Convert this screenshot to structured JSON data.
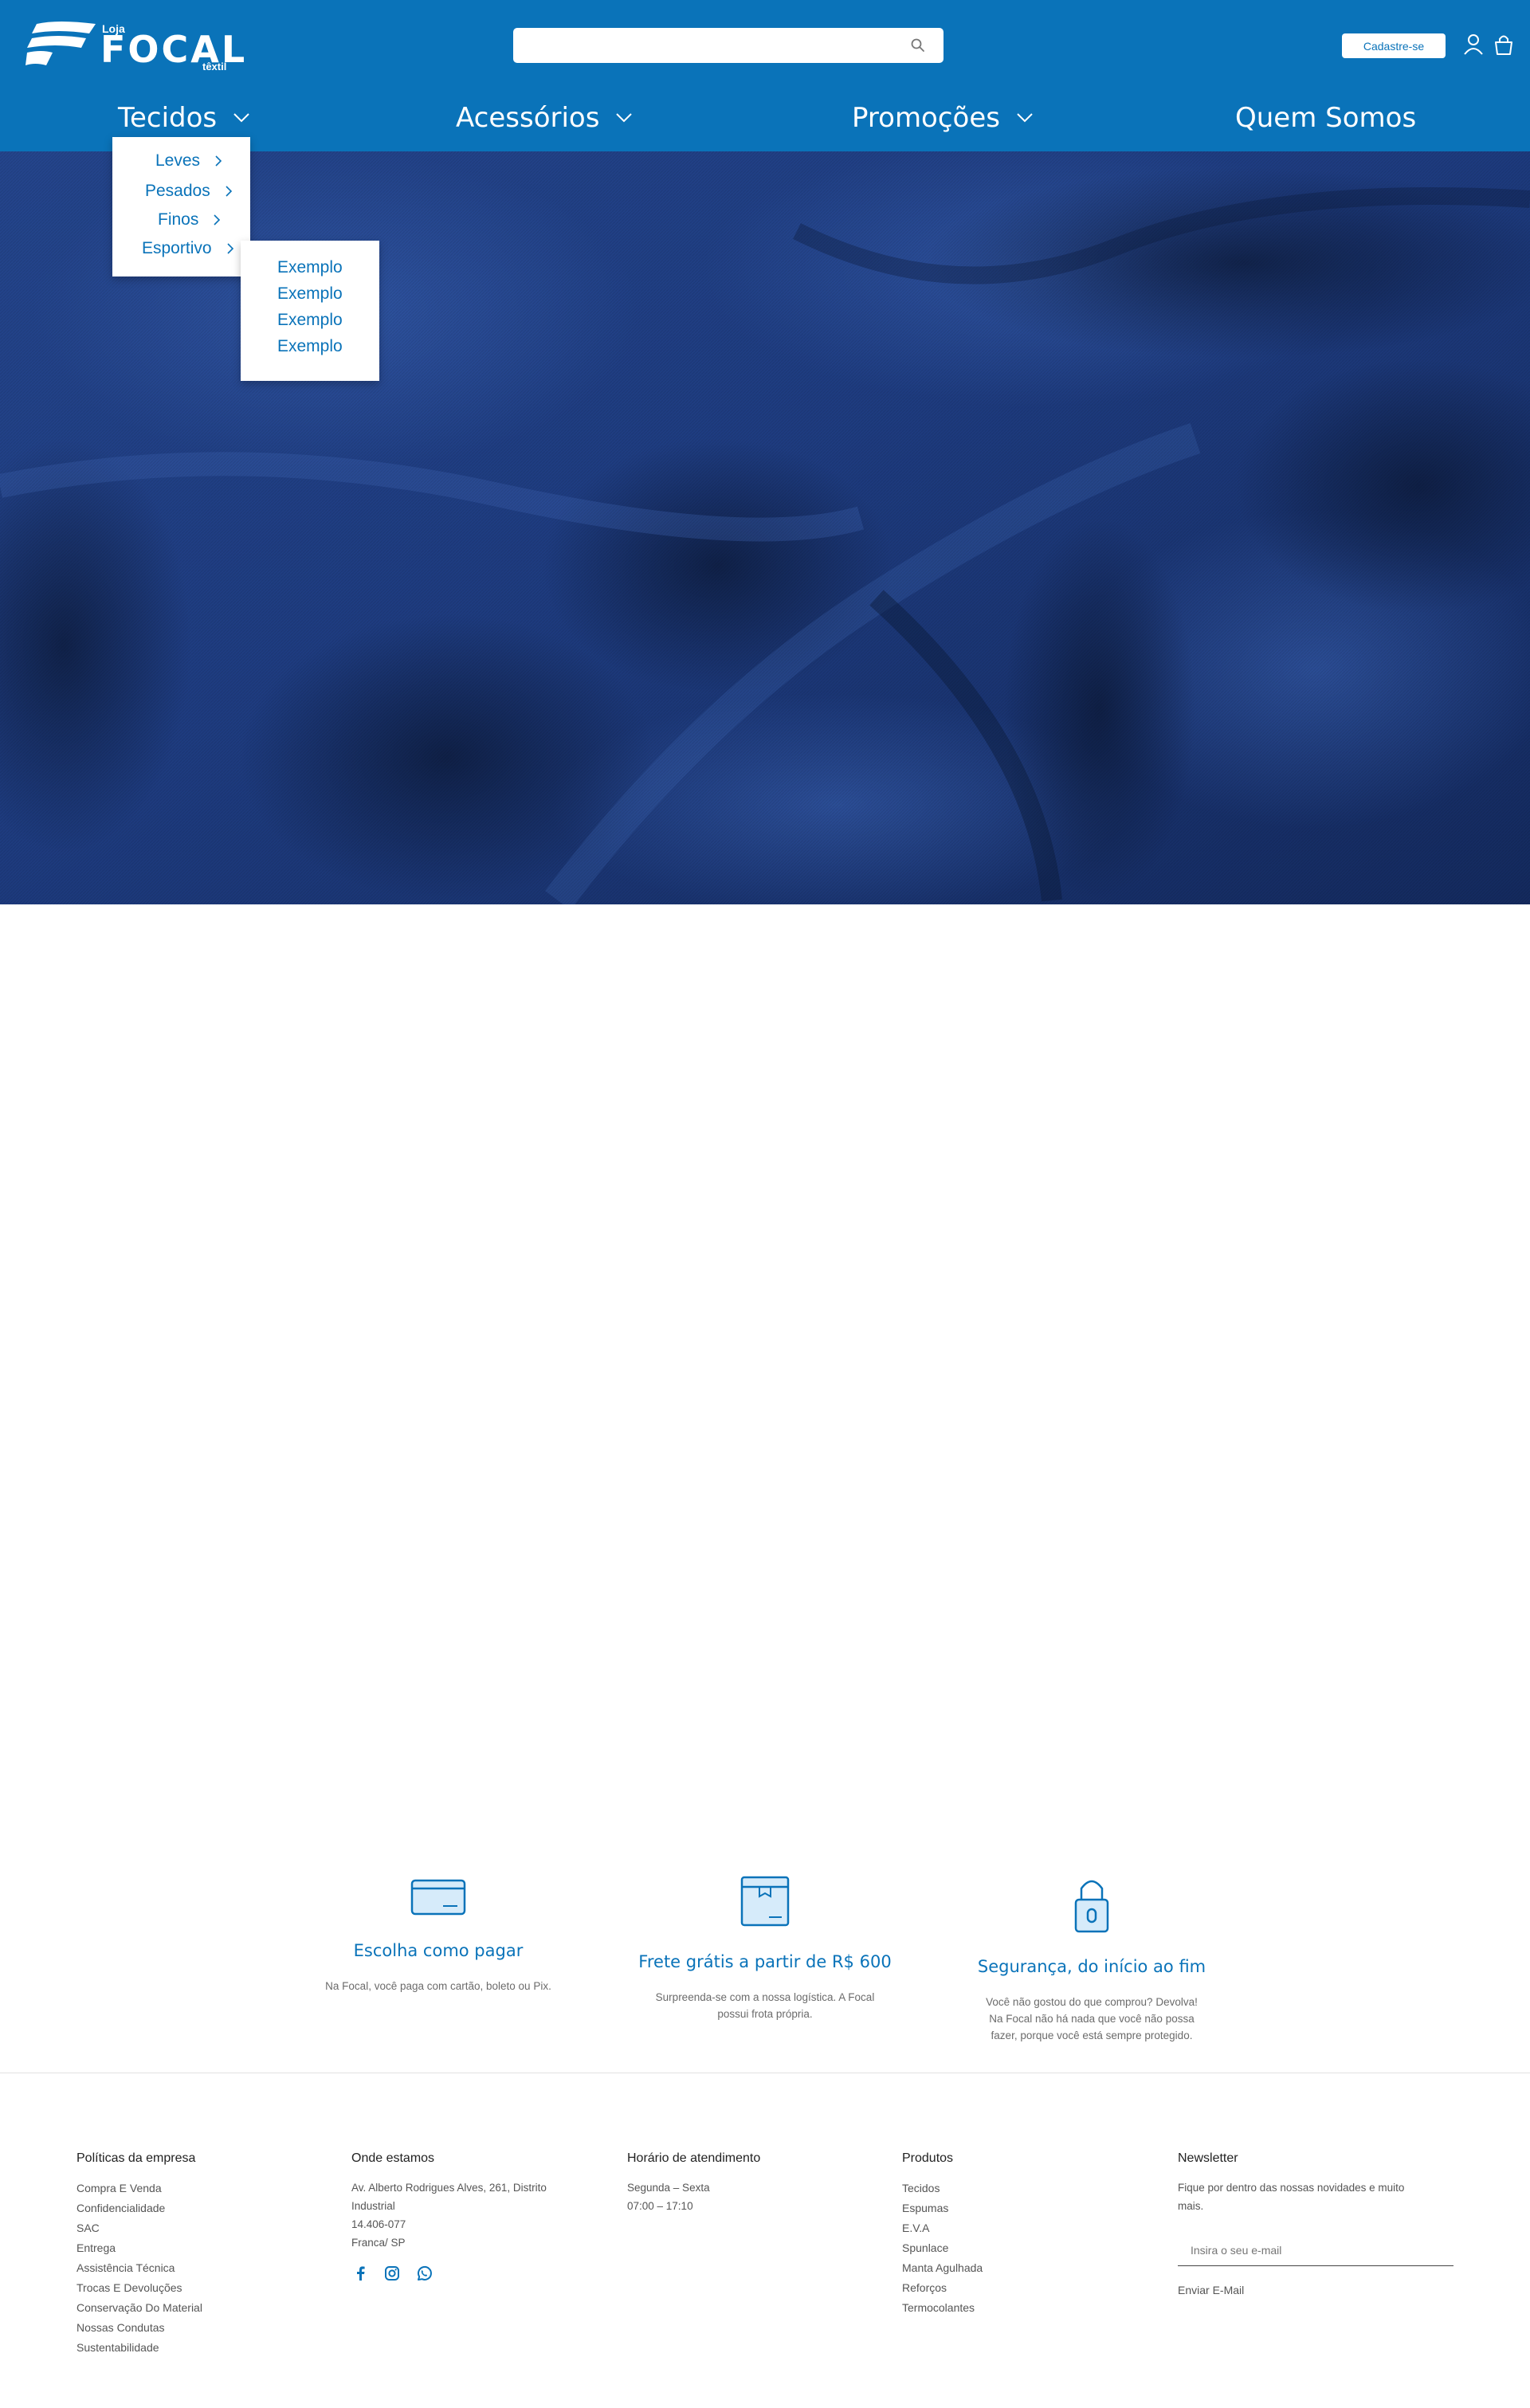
{
  "brand": {
    "logo_small": "Loja",
    "logo_big": "FOCAL",
    "logo_sub": "têxtil"
  },
  "header": {
    "search_placeholder": "",
    "signup_label": "Cadastre-se"
  },
  "nav": {
    "items": [
      {
        "label": "Tecidos",
        "has_dropdown": true
      },
      {
        "label": "Acessórios",
        "has_dropdown": true
      },
      {
        "label": "Promoções",
        "has_dropdown": true
      },
      {
        "label": "Quem Somos",
        "has_dropdown": false
      }
    ]
  },
  "dropdown": {
    "items": [
      "Leves",
      "Pesados",
      "Finos",
      "Esportivo"
    ],
    "submenu": [
      "Exemplo",
      "Exemplo",
      "Exemplo",
      "Exemplo"
    ]
  },
  "features": [
    {
      "icon": "credit-card-icon",
      "title": "Escolha como pagar",
      "text": "Na Focal, você paga com cartão, boleto ou Pix."
    },
    {
      "icon": "box-icon",
      "title": "Frete grátis a partir de R$ 600",
      "text": "Surpreenda-se com a nossa logística. A Focal possui frota própria."
    },
    {
      "icon": "lock-icon",
      "title": "Segurança, do início ao fim",
      "text": "Você não gostou do que comprou? Devolva! Na Focal não há nada que você não possa fazer, porque você está sempre protegido."
    }
  ],
  "footer": {
    "policies": {
      "title": "Políticas da empresa",
      "items": [
        "Compra E Venda",
        "Confidencialidade",
        "SAC",
        "Entrega",
        "Assistência Técnica",
        "Trocas E Devoluções",
        "Conservação Do Material",
        "Nossas Condutas",
        "Sustentabilidade"
      ]
    },
    "location": {
      "title": "Onde estamos",
      "lines": [
        "Av. Alberto Rodrigues Alves, 261, Distrito Industrial",
        "14.406-077",
        "Franca/ SP"
      ]
    },
    "hours": {
      "title": "Horário de atendimento",
      "lines": [
        "Segunda – Sexta",
        "07:00 – 17:10"
      ]
    },
    "products": {
      "title": "Produtos",
      "items": [
        "Tecidos",
        "Espumas",
        "E.V.A",
        "Spunlace",
        "Manta Agulhada",
        "Reforços",
        "Termocolantes"
      ]
    },
    "newsletter": {
      "title": "Newsletter",
      "text": "Fique por dentro das nossas novidades e muito mais.",
      "placeholder": "Insira o seu e-mail",
      "send_label": "Enviar E-Mail"
    }
  },
  "colors": {
    "brand_blue": "#0a73b9",
    "hero_fabric": "#1d3b7f"
  }
}
